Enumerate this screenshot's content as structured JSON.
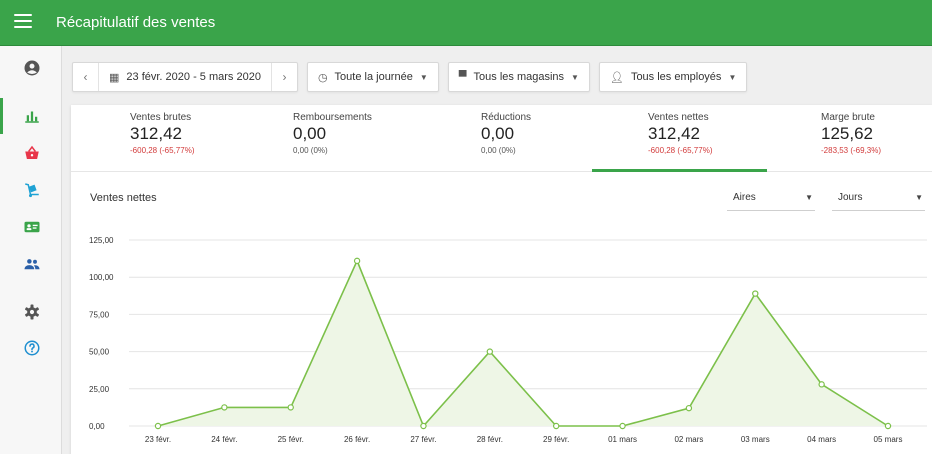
{
  "app": {
    "title": "Récapitulatif des ventes"
  },
  "nav": [
    {
      "name": "profile-icon",
      "active": false
    },
    {
      "name": "reports-icon",
      "active": true
    },
    {
      "name": "shopping-basket-icon",
      "active": false
    },
    {
      "name": "inventory-icon",
      "active": false
    },
    {
      "name": "customers-icon",
      "active": false
    },
    {
      "name": "employees-icon",
      "active": false
    },
    {
      "name": "settings-icon",
      "active": false
    },
    {
      "name": "help-icon",
      "active": false
    }
  ],
  "filters": {
    "date_range": "23 févr. 2020 - 5 mars 2020",
    "time": "Toute la journée",
    "stores": "Tous les magasins",
    "employees": "Tous les employés"
  },
  "summary": [
    {
      "label": "Ventes brutes",
      "value": "312,42",
      "change": "-600,28 (-65,77%)",
      "negative": true
    },
    {
      "label": "Remboursements",
      "value": "0,00",
      "change": "0,00 (0%)",
      "negative": false
    },
    {
      "label": "Réductions",
      "value": "0,00",
      "change": "0,00 (0%)",
      "negative": false
    },
    {
      "label": "Ventes nettes",
      "value": "312,42",
      "change": "-600,28 (-65,77%)",
      "negative": true
    },
    {
      "label": "Marge brute",
      "value": "125,62",
      "change": "-283,53 (-69,3%)",
      "negative": true
    }
  ],
  "chart_panel": {
    "title": "Ventes nettes",
    "chart_type_select": "Aires",
    "period_select": "Jours"
  },
  "colors": {
    "brand": "#3aa44a",
    "line": "#7cc04a",
    "area": "#eef6e6",
    "negative": "#d23b3b"
  },
  "chart_data": {
    "type": "area",
    "title": "Ventes nettes",
    "categories": [
      "23 févr.",
      "24 févr.",
      "25 févr.",
      "26 févr.",
      "27 févr.",
      "28 févr.",
      "29 févr.",
      "01 mars",
      "02 mars",
      "03 mars",
      "04 mars",
      "05 mars"
    ],
    "values": [
      0,
      12.5,
      12.5,
      111,
      0,
      50,
      0,
      0,
      12,
      89,
      28,
      0
    ],
    "ylim": [
      0,
      125
    ],
    "yticks": [
      0,
      25,
      50,
      75,
      100,
      125
    ],
    "ytick_labels": [
      "0,00",
      "25,00",
      "50,00",
      "75,00",
      "100,00",
      "125,00"
    ],
    "grid": true
  }
}
